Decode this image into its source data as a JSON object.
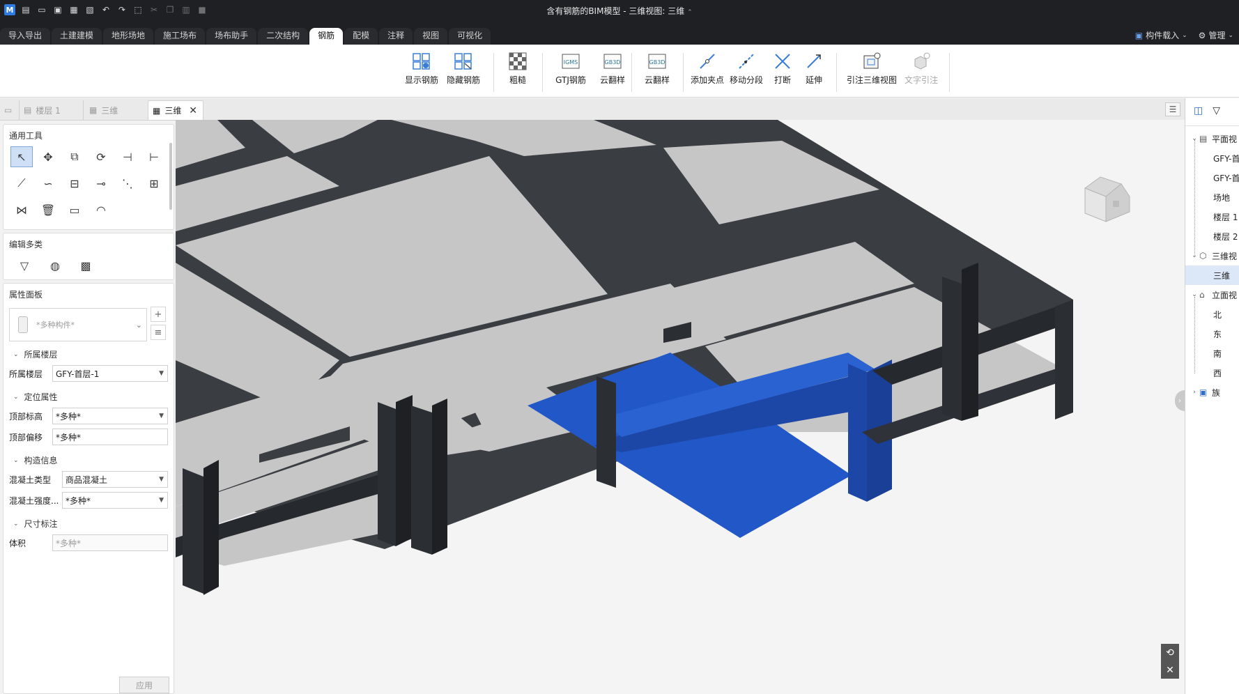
{
  "window": {
    "title": "含有钢筋的BIM模型 - 三维视图: 三维",
    "app_logo": "M"
  },
  "quick_access": [
    {
      "icon": "new-file-icon"
    },
    {
      "icon": "open-icon"
    },
    {
      "icon": "save-icon"
    },
    {
      "icon": "save-as-icon"
    },
    {
      "icon": "close-file-icon"
    },
    {
      "icon": "undo-icon"
    },
    {
      "icon": "redo-icon"
    },
    {
      "icon": "select-icon"
    },
    {
      "icon": "cut-icon"
    },
    {
      "icon": "copy-icon"
    },
    {
      "icon": "paste-icon"
    },
    {
      "icon": "format-icon"
    }
  ],
  "ribbon_tabs": [
    "导入导出",
    "土建建模",
    "地形场地",
    "施工场布",
    "场布助手",
    "二次结构",
    "钢筋",
    "配模",
    "注释",
    "视图",
    "可视化"
  ],
  "active_tab": "钢筋",
  "top_right": {
    "load_components": "构件载入",
    "manage": "管理"
  },
  "ribbon_buttons": [
    {
      "label": "显示钢筋",
      "icon": "show-rebar-icon",
      "enabled": true
    },
    {
      "label": "隐藏钢筋",
      "icon": "hide-rebar-icon",
      "enabled": true
    },
    {
      "label": "粗糙",
      "icon": "rough-icon",
      "enabled": true
    },
    {
      "label": "GTJ钢筋",
      "icon": "gtj-rebar-icon",
      "enabled": true
    },
    {
      "label": "云翻样",
      "icon": "cloud-detail-icon",
      "enabled": true
    },
    {
      "label": "云翻样",
      "icon": "cloud-detail-2-icon",
      "enabled": true
    },
    {
      "label": "添加夹点",
      "icon": "add-grip-icon",
      "enabled": true
    },
    {
      "label": "移动分段",
      "icon": "move-segment-icon",
      "enabled": true
    },
    {
      "label": "打断",
      "icon": "break-icon",
      "enabled": true
    },
    {
      "label": "延伸",
      "icon": "extend-icon",
      "enabled": true
    },
    {
      "label": "引注三维视图",
      "icon": "annotate-3d-icon",
      "enabled": true
    },
    {
      "label": "文字引注",
      "icon": "text-annotation-icon",
      "enabled": false
    }
  ],
  "view_tabs": [
    {
      "label": "楼层 1",
      "active": false
    },
    {
      "label": "三维",
      "active": false
    },
    {
      "label": "三维",
      "active": true
    }
  ],
  "left_panel": {
    "general_tools_title": "通用工具",
    "edit_multi_title": "编辑多类",
    "props_title": "属性面板",
    "type_selector": "*多种构件*",
    "sections": {
      "floor": "所属楼层",
      "position": "定位属性",
      "construction": "构造信息",
      "dimension": "尺寸标注"
    },
    "fields": {
      "floor_label": "所属楼层",
      "floor_value": "GFY-首层-1",
      "top_elev_label": "顶部标高",
      "top_elev_value": "*多种*",
      "top_offset_label": "顶部偏移",
      "top_offset_value": "*多种*",
      "concrete_type_label": "混凝土类型",
      "concrete_type_value": "商品混凝土",
      "concrete_strength_label": "混凝土强度...",
      "concrete_strength_value": "*多种*",
      "volume_label": "体积",
      "volume_value": "*多种*"
    },
    "apply": "应用"
  },
  "browser": {
    "items": [
      {
        "label": "平面视",
        "type": "group"
      },
      {
        "label": "GFY-首层",
        "type": "child"
      },
      {
        "label": "GFY-首层",
        "type": "child"
      },
      {
        "label": "场地",
        "type": "child"
      },
      {
        "label": "楼层 1",
        "type": "child"
      },
      {
        "label": "楼层 2",
        "type": "child"
      },
      {
        "label": "三维视",
        "type": "group"
      },
      {
        "label": "三维",
        "type": "child",
        "selected": true
      },
      {
        "label": "立面视",
        "type": "group"
      },
      {
        "label": "北",
        "type": "child"
      },
      {
        "label": "东",
        "type": "child"
      },
      {
        "label": "南",
        "type": "child"
      },
      {
        "label": "西",
        "type": "child"
      },
      {
        "label": "族",
        "type": "group-collapsed"
      }
    ]
  },
  "colors": {
    "selection_blue": "#2257c7",
    "slab_grey": "#c6c6c6",
    "beam_dark": "#2b2e33",
    "titlebar": "#1f2023"
  }
}
